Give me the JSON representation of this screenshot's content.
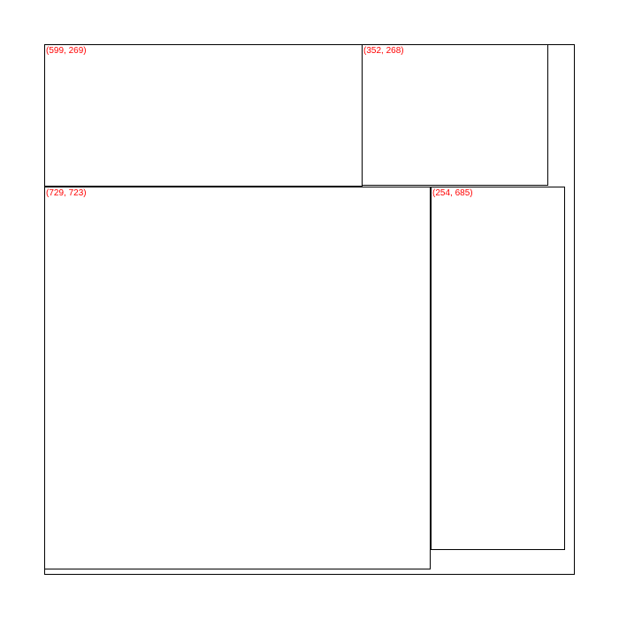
{
  "colors": {
    "label": "#ff0000",
    "stroke": "#000000",
    "background": "#ffffff"
  },
  "rectangles": [
    {
      "label": "(599, 269)",
      "size": [
        599,
        269
      ]
    },
    {
      "label": "(352, 268)",
      "size": [
        352,
        268
      ]
    },
    {
      "label": "(729, 723)",
      "size": [
        729,
        723
      ]
    },
    {
      "label": "(254, 685)",
      "size": [
        254,
        685
      ]
    }
  ]
}
